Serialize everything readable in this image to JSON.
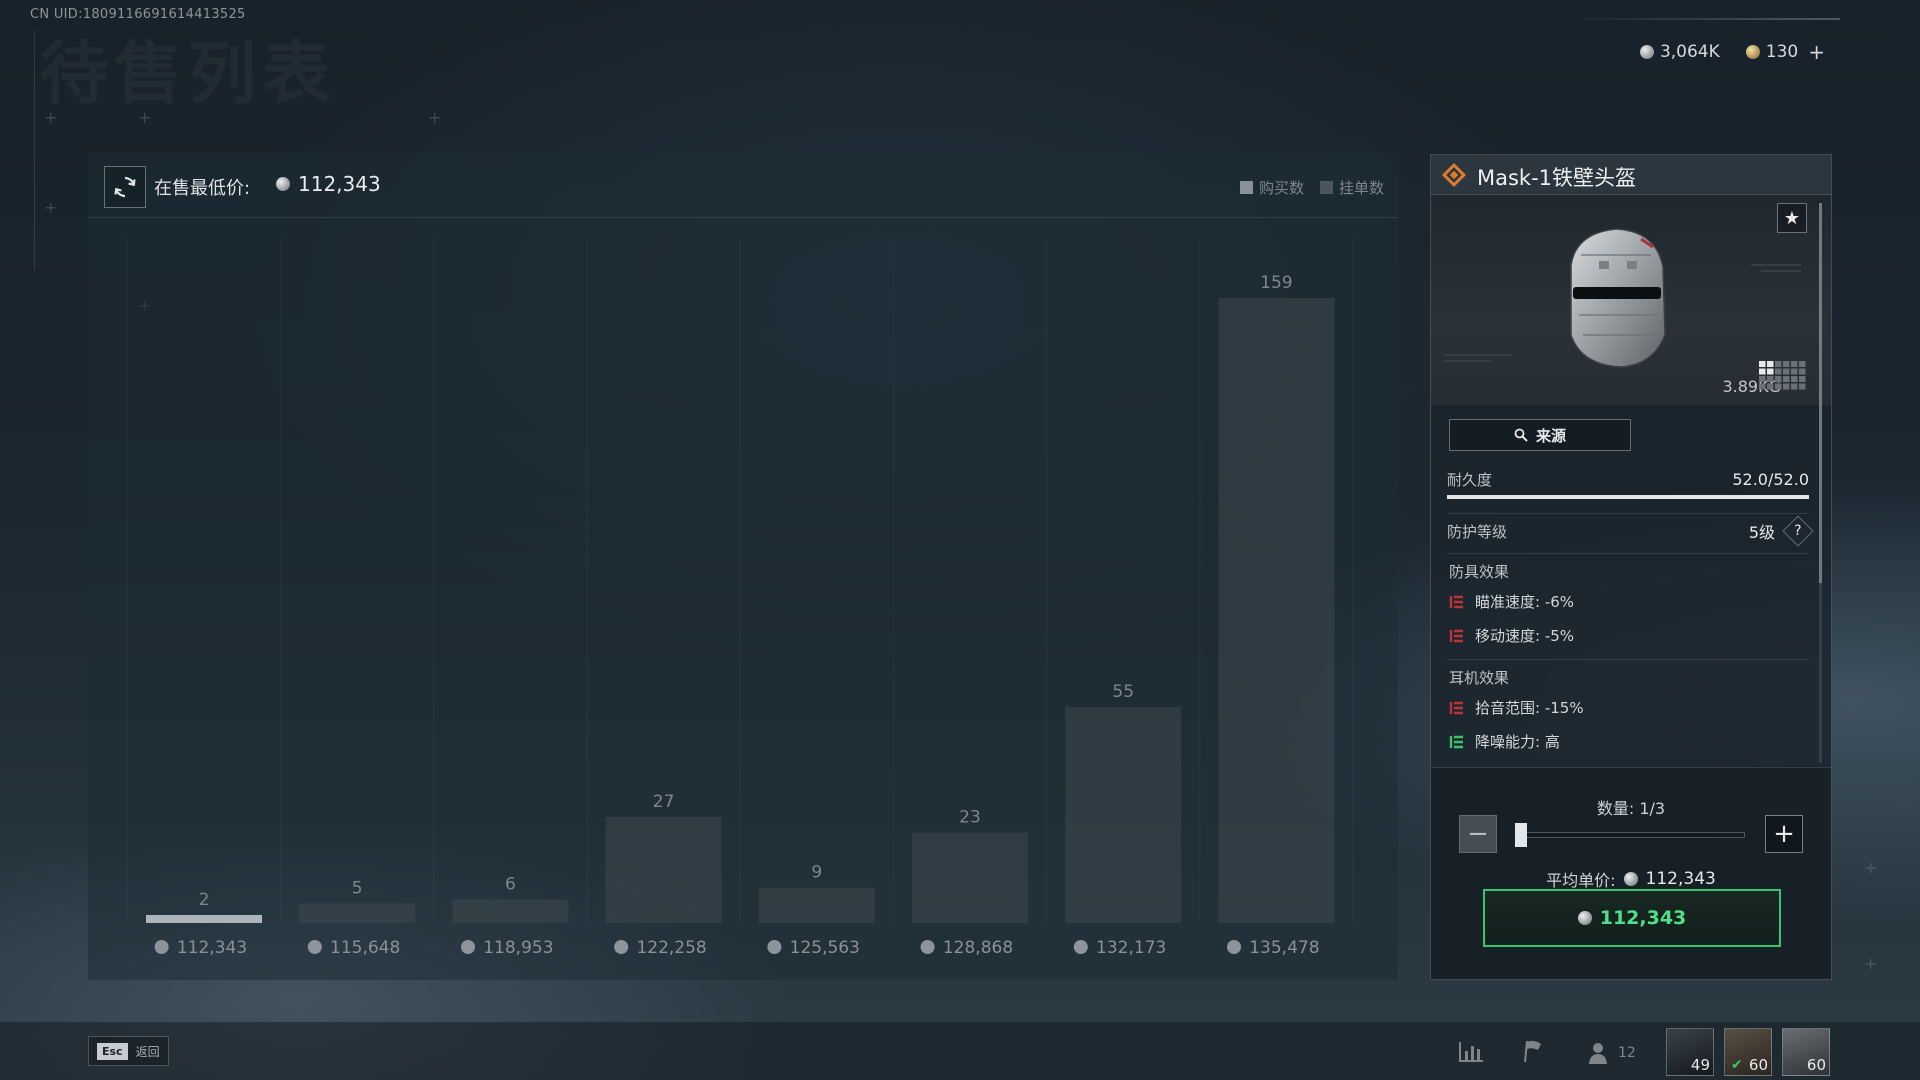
{
  "header": {
    "uid": "CN UID:1809116691614413525",
    "ghost_title": "待售列表"
  },
  "currency": {
    "silver": "3,064K",
    "gold": "130",
    "add_label": "+"
  },
  "chart_panel": {
    "lowest_label": "在售最低价:",
    "lowest_price": "112,343",
    "legend_buy": "购买数",
    "legend_list": "挂单数"
  },
  "chart_data": {
    "type": "bar",
    "categories": [
      "112,343",
      "115,648",
      "118,953",
      "122,258",
      "125,563",
      "128,868",
      "132,173",
      "135,478"
    ],
    "values": [
      2,
      5,
      6,
      27,
      9,
      23,
      55,
      159
    ],
    "highlight_index": 0,
    "ylim": [
      0,
      159
    ],
    "grid": true
  },
  "item": {
    "name": "Mask-1铁壁头盔",
    "weight": "3.89KG",
    "source_label": "来源",
    "durability_label": "耐久度",
    "durability_value": "52.0/52.0",
    "durability_fraction": 1.0,
    "protection_label": "防护等级",
    "protection_value": "5级",
    "help_label": "?",
    "armor_effects_title": "防具效果",
    "armor_effects": [
      "瞄准速度: -6%",
      "移动速度: -5%"
    ],
    "headset_effects_title": "耳机效果",
    "headset_effects": [
      "拾音范围: -15%",
      "降噪能力: 高"
    ],
    "headset_effect_kinds": [
      "negative",
      "positive"
    ]
  },
  "purchase": {
    "qty_label": "数量: 1/3",
    "qty_fraction": 0.0,
    "minus": "−",
    "plus": "+",
    "avg_label": "平均单价:",
    "avg_price": "112,343",
    "buy_price": "112,343"
  },
  "bottom": {
    "esc_key": "Esc",
    "esc_label": "返回",
    "friends_count": "12",
    "avatar_levels": [
      "49",
      "60",
      "60"
    ]
  },
  "colors": {
    "buy_accent": "#38c46e",
    "negative_effect": "#c0323a",
    "positive_effect": "#3cc46a",
    "rarity": "#e07a2e"
  }
}
